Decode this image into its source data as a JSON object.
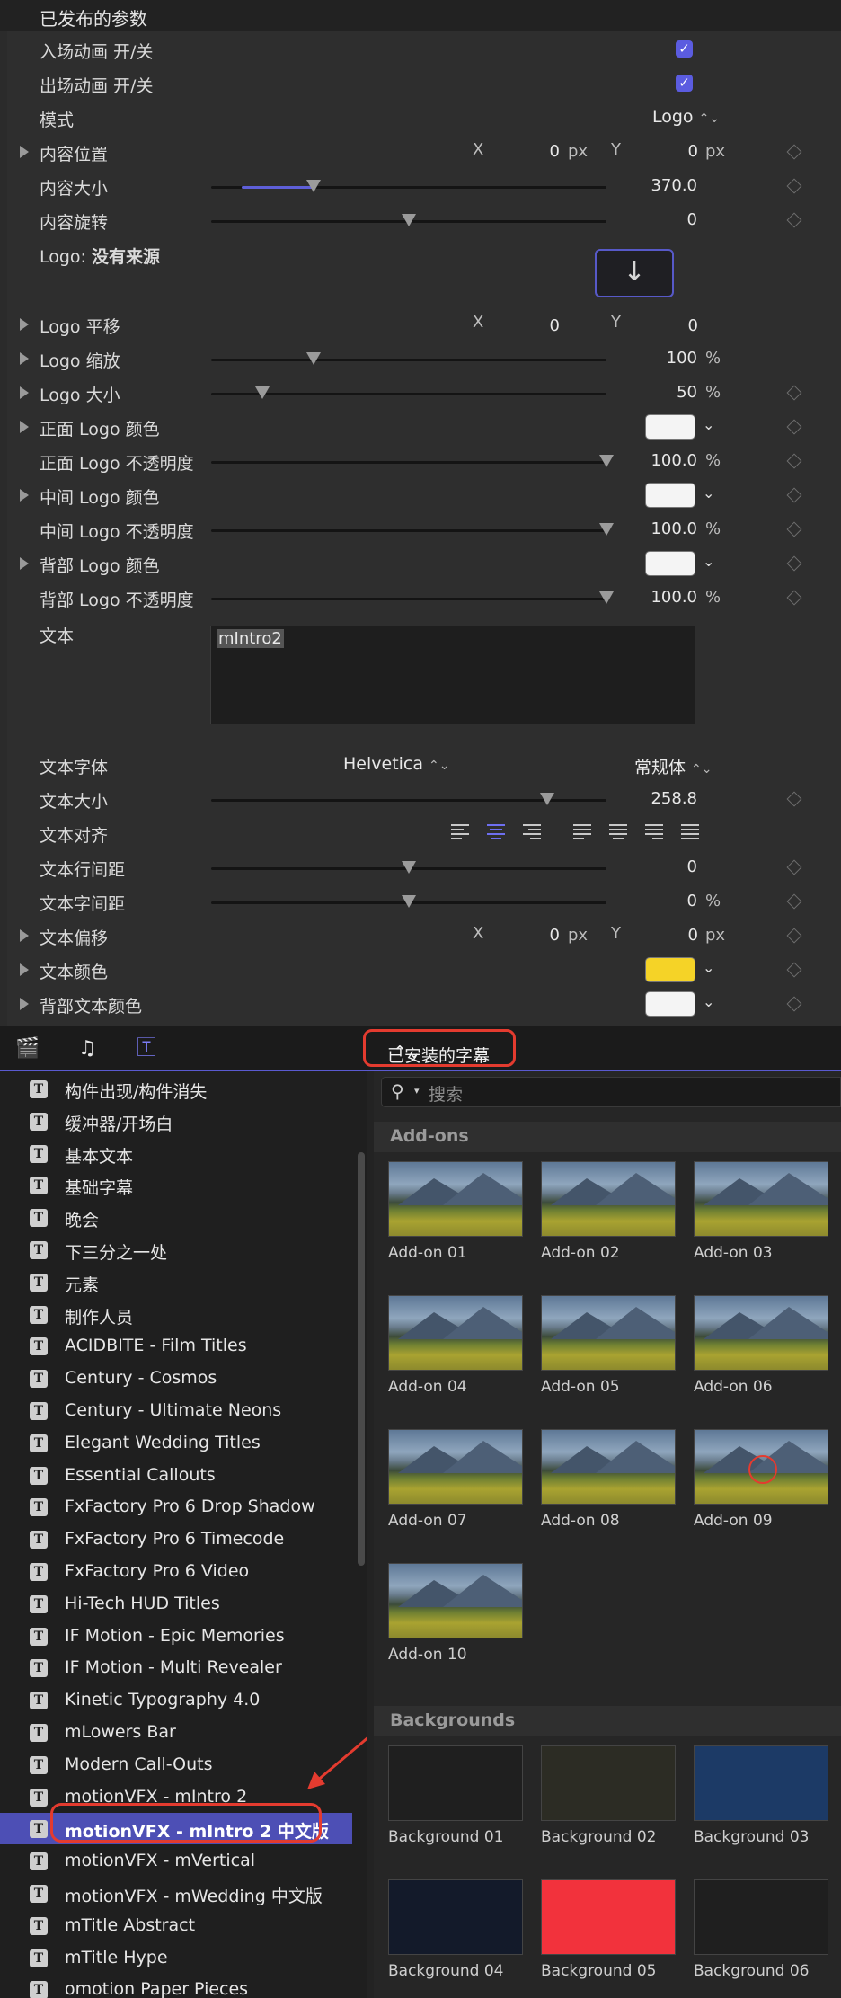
{
  "inspector": {
    "section_title": "已发布的参数",
    "params": {
      "intro_anim": {
        "label": "入场动画 开/关"
      },
      "outro_anim": {
        "label": "出场动画 开/关"
      },
      "mode": {
        "label": "模式",
        "value": "Logo"
      },
      "content_pos": {
        "label": "内容位置",
        "x_label": "X",
        "x": "0",
        "x_unit": "px",
        "y_label": "Y",
        "y": "0",
        "y_unit": "px"
      },
      "content_size": {
        "label": "内容大小",
        "value": "370.0",
        "level": 0.26
      },
      "content_rot": {
        "label": "内容旋转",
        "value": "0",
        "level": 0.5
      },
      "logo_source": {
        "label": "Logo:",
        "status": "没有来源"
      },
      "logo_pan": {
        "label": "Logo 平移",
        "x_label": "X",
        "x": "0",
        "y_label": "Y",
        "y": "0"
      },
      "logo_scale": {
        "label": "Logo 缩放",
        "value": "100",
        "unit": "%",
        "level": 0.26
      },
      "logo_size": {
        "label": "Logo 大小",
        "value": "50",
        "unit": "%",
        "level": 0.13
      },
      "front_color": {
        "label": "正面 Logo 颜色",
        "color": "#f4f4f4"
      },
      "front_opacity": {
        "label": "正面 Logo 不透明度",
        "value": "100.0",
        "unit": "%",
        "level": 1.0
      },
      "mid_color": {
        "label": "中间 Logo 颜色",
        "color": "#f4f4f4"
      },
      "mid_opacity": {
        "label": "中间 Logo 不透明度",
        "value": "100.0",
        "unit": "%",
        "level": 1.0
      },
      "back_color": {
        "label": "背部 Logo 颜色",
        "color": "#f4f4f4"
      },
      "back_opacity": {
        "label": "背部 Logo 不透明度",
        "value": "100.0",
        "unit": "%",
        "level": 1.0
      },
      "text": {
        "label": "文本",
        "value": "mIntro2"
      },
      "text_font": {
        "label": "文本字体",
        "family": "Helvetica",
        "style": "常规体"
      },
      "text_size": {
        "label": "文本大小",
        "value": "258.8",
        "level": 0.85
      },
      "text_align": {
        "label": "文本对齐"
      },
      "line_spacing": {
        "label": "文本行间距",
        "value": "0",
        "level": 0.5
      },
      "char_spacing": {
        "label": "文本字间距",
        "value": "0",
        "unit": "%",
        "level": 0.5
      },
      "text_offset": {
        "label": "文本偏移",
        "x_label": "X",
        "x": "0",
        "x_unit": "px",
        "y_label": "Y",
        "y": "0",
        "y_unit": "px"
      },
      "text_color": {
        "label": "文本颜色",
        "color": "#f5d327"
      },
      "bg_text_color": {
        "label": "背部文本颜色",
        "color": "#f4f4f4"
      }
    }
  },
  "toolbar": {
    "icons": [
      "clapper-icon",
      "music-icon",
      "titles-icon"
    ],
    "library_select": "已安装的字幕"
  },
  "sidebar": {
    "items": [
      "构件出现/构件消失",
      "缓冲器/开场白",
      "基本文本",
      "基础字幕",
      "晚会",
      "下三分之一处",
      "元素",
      "制作人员",
      "ACIDBITE - Film Titles",
      "Century - Cosmos",
      "Century - Ultimate Neons",
      "Elegant Wedding Titles",
      "Essential Callouts",
      "FxFactory Pro 6 Drop Shadow",
      "FxFactory Pro 6 Timecode",
      "FxFactory Pro 6 Video",
      "Hi-Tech HUD Titles",
      "IF Motion - Epic Memories",
      "IF Motion - Multi Revealer",
      "Kinetic Typography 4.0",
      "mLowers Bar",
      "Modern Call-Outs",
      "motionVFX - mIntro 2",
      "motionVFX - mIntro 2 中文版",
      "motionVFX - mVertical",
      "motionVFX - mWedding 中文版",
      "mTitle Abstract",
      "mTitle Hype",
      "omotion Paper Pieces"
    ],
    "selected_index": 23
  },
  "grid": {
    "search_placeholder": "搜索",
    "groups": [
      {
        "title": "Add-ons",
        "tiles": [
          "Add-on 01",
          "Add-on 02",
          "Add-on 03",
          "Add-on 04",
          "Add-on 05",
          "Add-on 06",
          "Add-on 07",
          "Add-on 08",
          "Add-on 09",
          "Add-on 10"
        ]
      },
      {
        "title": "Backgrounds",
        "tiles": [
          "Background 01",
          "Background 02",
          "Background 03",
          "Background 04",
          "Background 05",
          "Background 06"
        ],
        "colors": [
          "#1f1f1f",
          "#2c2c24",
          "#1c3a66",
          "#131a2a",
          "#f2323c",
          "#1f1f1f"
        ]
      }
    ]
  },
  "colors": {
    "accent": "#5b5ce0",
    "annotation_red": "#e43b2f"
  }
}
